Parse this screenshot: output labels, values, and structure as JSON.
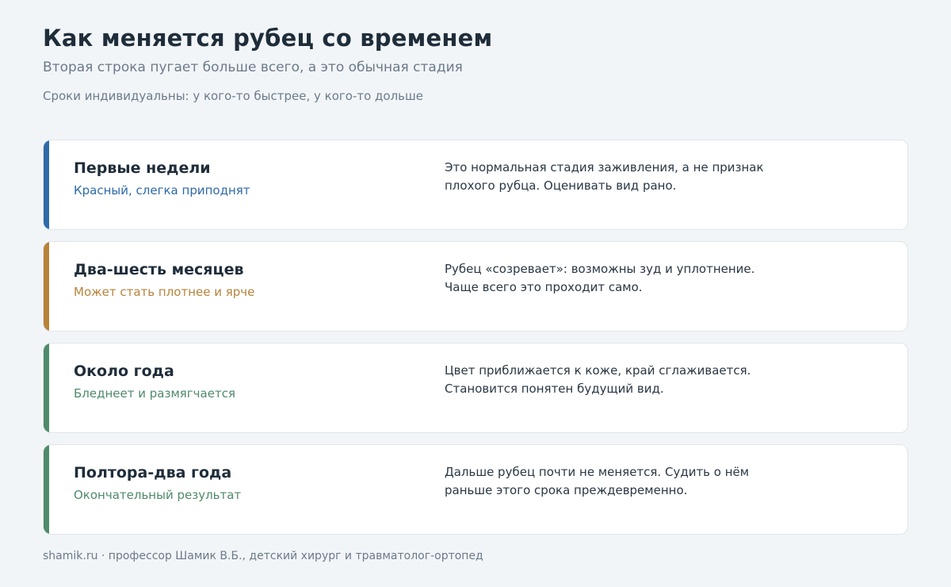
{
  "header": {
    "title": "Как меняется рубец со временем",
    "subtitle": "Вторая строка пугает больше всего, а это обычная стадия",
    "note": "Сроки индивидуальны: у кого-то быстрее, у кого-то дольше"
  },
  "stages": [
    {
      "title": "Первые недели",
      "subtitle": "Красный, слегка приподнят",
      "description_line1": "Это нормальная стадия заживления, а не признак",
      "description_line2": "плохого рубца. Оценивать вид рано.",
      "accent_color": "#2f6aa9"
    },
    {
      "title": "Два-шесть месяцев",
      "subtitle": "Может стать плотнее и ярче",
      "description_line1": "Рубец «созревает»: возможны зуд и уплотнение.",
      "description_line2": "Чаще всего это проходит само.",
      "accent_color": "#b7833a"
    },
    {
      "title": "Около года",
      "subtitle": "Бледнеет и размягчается",
      "description_line1": "Цвет приближается к коже, край сглаживается.",
      "description_line2": "Становится понятен будущий вид.",
      "accent_color": "#4f8a6b"
    },
    {
      "title": "Полтора-два года",
      "subtitle": "Окончательный результат",
      "description_line1": "Дальше рубец почти не меняется. Судить о нём",
      "description_line2": "раньше этого срока преждевременно.",
      "accent_color": "#4f8a6b"
    }
  ],
  "footer": {
    "text": "shamik.ru · профессор Шамик В.Б., детский хирург и травматолог-ортопед"
  }
}
